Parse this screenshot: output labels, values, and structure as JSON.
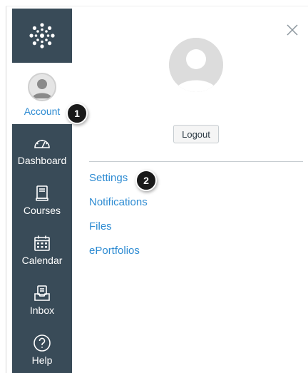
{
  "global_nav": {
    "logo_icon": "canvas-logo-icon",
    "account": {
      "label": "Account",
      "icon": "avatar-icon"
    },
    "items": [
      {
        "label": "Dashboard",
        "icon": "dashboard-icon"
      },
      {
        "label": "Courses",
        "icon": "courses-icon"
      },
      {
        "label": "Calendar",
        "icon": "calendar-icon"
      },
      {
        "label": "Inbox",
        "icon": "inbox-icon"
      },
      {
        "label": "Help",
        "icon": "help-icon"
      }
    ],
    "colors": {
      "background": "#394b58",
      "accent": "#2d8bd2"
    }
  },
  "account_tray": {
    "close_icon": "close-icon",
    "avatar_icon": "avatar-icon",
    "logout_label": "Logout",
    "links": [
      {
        "label": "Settings"
      },
      {
        "label": "Notifications"
      },
      {
        "label": "Files"
      },
      {
        "label": "ePortfolios"
      }
    ]
  },
  "badges": {
    "account": "1",
    "settings": "2"
  }
}
